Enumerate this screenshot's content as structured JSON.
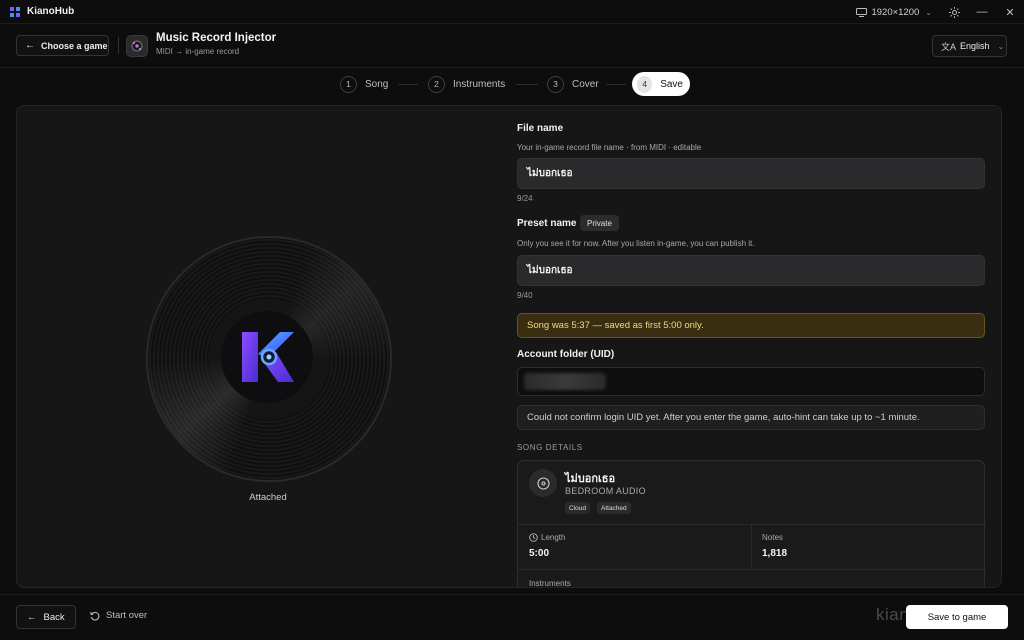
{
  "window": {
    "app_name": "KianoHub",
    "resolution": "1920×1200",
    "icons": [
      "monitor-icon",
      "sun-icon",
      "minimize-icon",
      "close-icon"
    ]
  },
  "header": {
    "choose_label": "Choose a game",
    "tool_title": "Music Record Injector",
    "tool_subtitle": "MIDI → in-game record",
    "language": "English"
  },
  "steps": [
    {
      "num": "1",
      "label": "Song"
    },
    {
      "num": "2",
      "label": "Instruments"
    },
    {
      "num": "3",
      "label": "Cover"
    },
    {
      "num": "4",
      "label": "Save"
    }
  ],
  "preview": {
    "status": "Attached"
  },
  "form": {
    "file_name_label": "File name",
    "file_name_help": "Your in-game record file name · from MIDI · editable",
    "file_name_value": "ไม่บอกเธอ",
    "file_name_count": "9/24",
    "preset_label": "Preset name",
    "preset_chip": "Private",
    "preset_help": "Only you see it for now. After you listen in-game, you can publish it.",
    "preset_value": "ไม่บอกเธอ",
    "preset_count": "9/40",
    "warning": "Song was 5:37 — saved as first 5:00 only.",
    "uid_label": "Account folder (UID)",
    "uid_info": "Could not confirm login UID yet. After you enter the game, auto-hint can take up to ~1 minute."
  },
  "song": {
    "section_label": "SONG DETAILS",
    "title": "ไม่บอกเธอ",
    "artist": "BEDROOM AUDIO",
    "tags": [
      "Cloud",
      "Attached"
    ],
    "length_label": "Length",
    "length_value": "5:00",
    "notes_label": "Notes",
    "notes_value": "1,818",
    "instruments_label": "Instruments"
  },
  "footer": {
    "back_label": "Back",
    "start_over_label": "Start over",
    "watermark": "kian",
    "save_label": "Save to game"
  },
  "colors": {
    "background": "#0d0d0e",
    "panel": "#161617",
    "warning_bg": "#3a2e10",
    "warning_text": "#f3d78a",
    "logo_purple": "#7b3fe4",
    "logo_blue": "#3a7bff"
  }
}
